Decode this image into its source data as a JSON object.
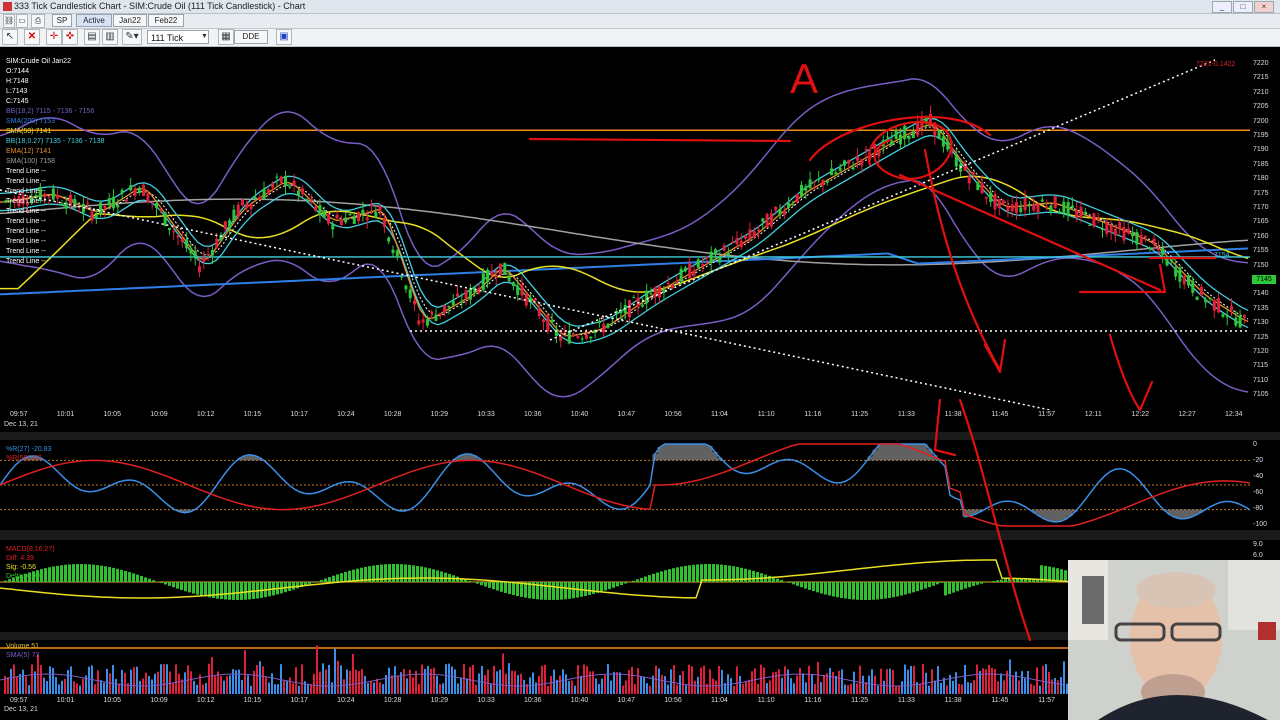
{
  "window": {
    "title": "333 Tick Candlestick Chart - SIM:Crude Oil (111 Tick Candlestick) - Chart",
    "minimize": "_",
    "maximize": "□",
    "close": "×"
  },
  "toolbar1": {
    "symbol_btn": "SP",
    "active_btn": "Active",
    "jan_btn": "Jan22",
    "feb_btn": "Feb22"
  },
  "toolbar2": {
    "interval_value": "111 Tick",
    "dde_label": "DDE"
  },
  "price_panel": {
    "legend": [
      {
        "text": "SIM:Crude Oil Jan22",
        "color": "#ffffff"
      },
      {
        "text": "O:7144",
        "color": "#ffffff"
      },
      {
        "text": "H:7148",
        "color": "#ffffff"
      },
      {
        "text": "L:7143",
        "color": "#ffffff"
      },
      {
        "text": "C:7145",
        "color": "#ffffff"
      },
      {
        "text": "BB(18,2) 7115 - 7136 - 7156",
        "color": "#7a5cc4"
      },
      {
        "text": "SMA(200) 7153",
        "color": "#2f7fe8"
      },
      {
        "text": "SMA(50) 7141",
        "color": "#e8e020"
      },
      {
        "text": "BB(18,0.27) 7135 - 7136 - 7138",
        "color": "#40d0e0"
      },
      {
        "text": "EMA(12) 7141",
        "color": "#e8902a"
      },
      {
        "text": "SMA(100) 7158",
        "color": "#a0a0a0"
      },
      {
        "text": "Trend Line --",
        "color": "#ffffff"
      },
      {
        "text": "Trend Line --",
        "color": "#ffffff"
      },
      {
        "text": "Trend Line --",
        "color": "#ffffff"
      },
      {
        "text": "Trend Line --",
        "color": "#ffffff"
      },
      {
        "text": "Trend Line --",
        "color": "#ffffff"
      },
      {
        "text": "Trend Line --",
        "color": "#ffffff"
      },
      {
        "text": "Trend Line --",
        "color": "#ffffff"
      },
      {
        "text": "Trend Line --",
        "color": "#ffffff"
      },
      {
        "text": "Trend Line --",
        "color": "#ffffff"
      },
      {
        "text": "Trend Line --",
        "color": "#ffffff"
      }
    ],
    "price_scale": [
      "7220",
      "7215",
      "7210",
      "7205",
      "7200",
      "7195",
      "7190",
      "7185",
      "7180",
      "7175",
      "7170",
      "7165",
      "7160",
      "7155",
      "7150",
      "7145",
      "7140",
      "7135",
      "7130",
      "7125",
      "7120",
      "7115",
      "7110",
      "7105"
    ],
    "time_labels": [
      "09:57",
      "10:01",
      "10:05",
      "10:09",
      "10:12",
      "10:15",
      "10:17",
      "10:24",
      "10:28",
      "10:29",
      "10:33",
      "10:36",
      "10:40",
      "10:47",
      "10:56",
      "11:04",
      "11:10",
      "11:16",
      "11:25",
      "11:33",
      "11:38",
      "11:45",
      "11:57",
      "12:11",
      "12:22",
      "12:27",
      "12:34"
    ],
    "date_label": "Dec 13, 21",
    "last_price_tag": "7145",
    "bb_tag": "7154",
    "top_right_tag": "7221-0.1422"
  },
  "wr_panel": {
    "legend": [
      {
        "text": "%R(27) -20.83",
        "color": "#3a8fe8"
      },
      {
        "text": "%R(50) -52",
        "color": "#e02020"
      }
    ],
    "scale": [
      "0",
      "-20",
      "-40",
      "-60",
      "-80",
      "-100"
    ]
  },
  "macd_panel": {
    "legend": [
      {
        "text": "MACD(8,16,27)",
        "color": "#e02020"
      },
      {
        "text": "Diff: 4.39",
        "color": "#e02020"
      },
      {
        "text": "Sig: -0.56",
        "color": "#e8e020"
      },
      {
        "text": "Delta: 4.90",
        "color": "#30c030"
      }
    ],
    "scale": [
      "9.0",
      "6.0"
    ]
  },
  "volume_panel": {
    "legend": [
      {
        "text": "Volume 51",
        "color": "#e8c040"
      },
      {
        "text": "SMA(5) 73",
        "color": "#7a5cc4"
      }
    ],
    "time_labels": [
      "09:57",
      "10:01",
      "10:05",
      "10:09",
      "10:12",
      "10:15",
      "10:17",
      "10:24",
      "10:28",
      "10:29",
      "10:33",
      "10:36",
      "10:40",
      "10:47",
      "10:56",
      "11:04",
      "11:10",
      "11:16",
      "11:25",
      "11:33",
      "11:38",
      "11:45",
      "11:57"
    ],
    "date_label": "Dec 13, 21"
  },
  "annotation": {
    "letter": "A"
  },
  "colors": {
    "bull": "#2fc73a",
    "bear": "#e0203a",
    "bb_outer": "#7a5cc4",
    "sma200": "#2f7fe8",
    "sma50": "#e8e020",
    "bb_inner": "#40d0e0",
    "ema12": "#e8902a",
    "sma100": "#a0a0a0",
    "orange_line": "#f08a18",
    "annotation_red": "#e01010"
  }
}
